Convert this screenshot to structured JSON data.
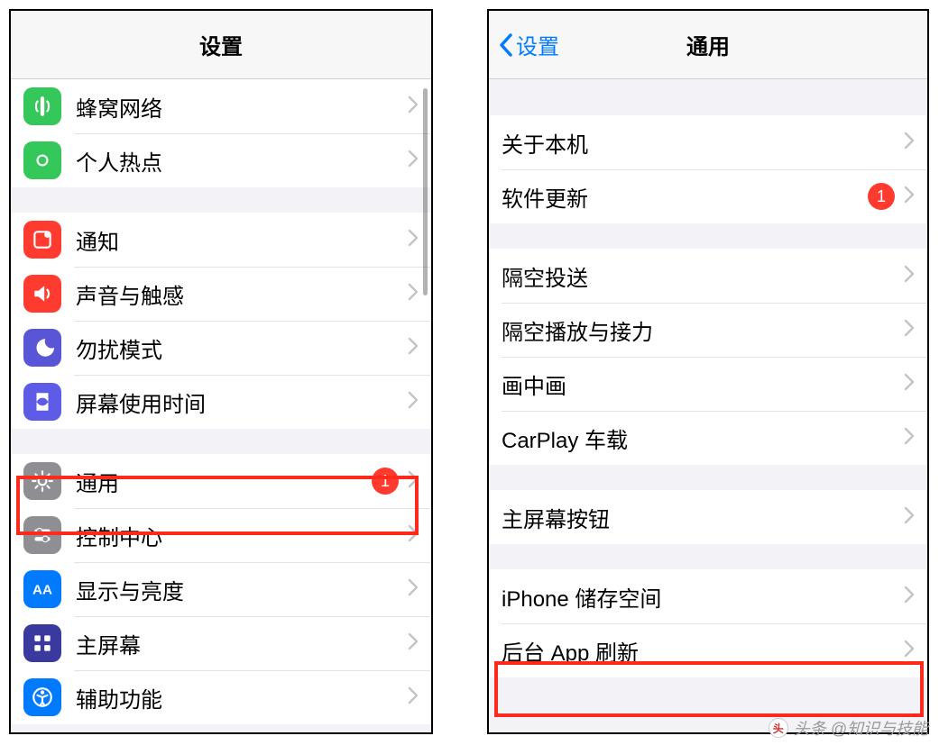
{
  "left": {
    "title": "设置",
    "groups": [
      [
        {
          "key": "cellular",
          "label": "蜂窝网络"
        },
        {
          "key": "hotspot",
          "label": "个人热点"
        }
      ],
      [
        {
          "key": "notifications",
          "label": "通知"
        },
        {
          "key": "sounds",
          "label": "声音与触感"
        },
        {
          "key": "dnd",
          "label": "勿扰模式"
        },
        {
          "key": "screentime",
          "label": "屏幕使用时间"
        }
      ],
      [
        {
          "key": "general",
          "label": "通用",
          "badge": "1",
          "highlight": true
        },
        {
          "key": "controlcenter",
          "label": "控制中心"
        },
        {
          "key": "display",
          "label": "显示与亮度"
        },
        {
          "key": "homescreen",
          "label": "主屏幕"
        },
        {
          "key": "accessibility",
          "label": "辅助功能"
        }
      ]
    ]
  },
  "right": {
    "back": "设置",
    "title": "通用",
    "groups": [
      [
        {
          "key": "about",
          "label": "关于本机"
        },
        {
          "key": "update",
          "label": "软件更新",
          "badge": "1"
        }
      ],
      [
        {
          "key": "airdrop",
          "label": "隔空投送"
        },
        {
          "key": "airplay",
          "label": "隔空播放与接力"
        },
        {
          "key": "pip",
          "label": "画中画"
        },
        {
          "key": "carplay",
          "label": "CarPlay 车载"
        }
      ],
      [
        {
          "key": "homebutton",
          "label": "主屏幕按钮"
        }
      ],
      [
        {
          "key": "storage",
          "label": "iPhone 储存空间"
        },
        {
          "key": "bgrefresh",
          "label": "后台 App 刷新",
          "highlight": true
        }
      ]
    ]
  },
  "watermark": "头条 @知识与技能"
}
